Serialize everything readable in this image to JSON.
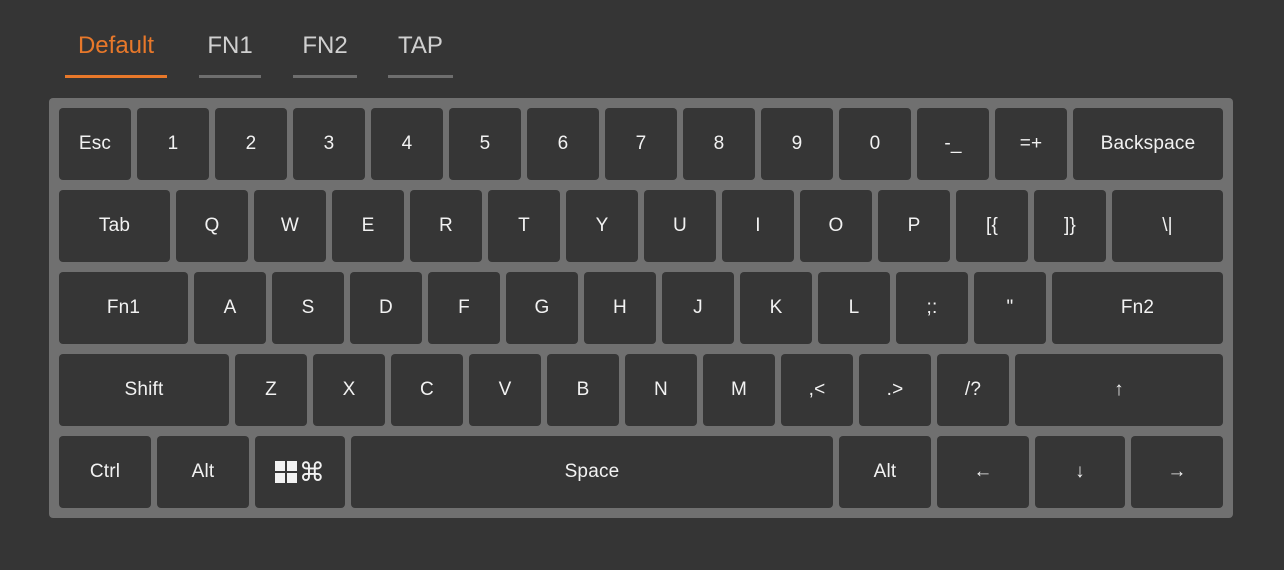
{
  "tabs": [
    {
      "label": "Default",
      "active": true
    },
    {
      "label": "FN1",
      "active": false
    },
    {
      "label": "FN2",
      "active": false
    },
    {
      "label": "TAP",
      "active": false
    }
  ],
  "colors": {
    "background": "#353535",
    "accent": "#e8782a",
    "keyboard_frame": "#707070",
    "key": "#363636",
    "key_text": "#f2f2f2",
    "tab_inactive": "#d0d0d0"
  },
  "keyboard": {
    "row0": [
      "Esc",
      "1",
      "2",
      "3",
      "4",
      "5",
      "6",
      "7",
      "8",
      "9",
      "0",
      "-_",
      "=+",
      "Backspace"
    ],
    "row1": [
      "Tab",
      "Q",
      "W",
      "E",
      "R",
      "T",
      "Y",
      "U",
      "I",
      "O",
      "P",
      "[{",
      "]}",
      "\\|"
    ],
    "row2": [
      "Fn1",
      "A",
      "S",
      "D",
      "F",
      "G",
      "H",
      "J",
      "K",
      "L",
      ";:",
      "\"",
      "Fn2"
    ],
    "row3": [
      "Shift",
      "Z",
      "X",
      "C",
      "V",
      "B",
      "N",
      "M",
      ",<",
      ".>",
      "/?",
      "↑"
    ],
    "row4": {
      "ctrl": "Ctrl",
      "alt_left": "Alt",
      "super_icon": "windows-command-icon",
      "super_glyph": "⌘",
      "space": "Space",
      "alt_right": "Alt",
      "left": "←",
      "down": "↓",
      "right": "→"
    }
  }
}
